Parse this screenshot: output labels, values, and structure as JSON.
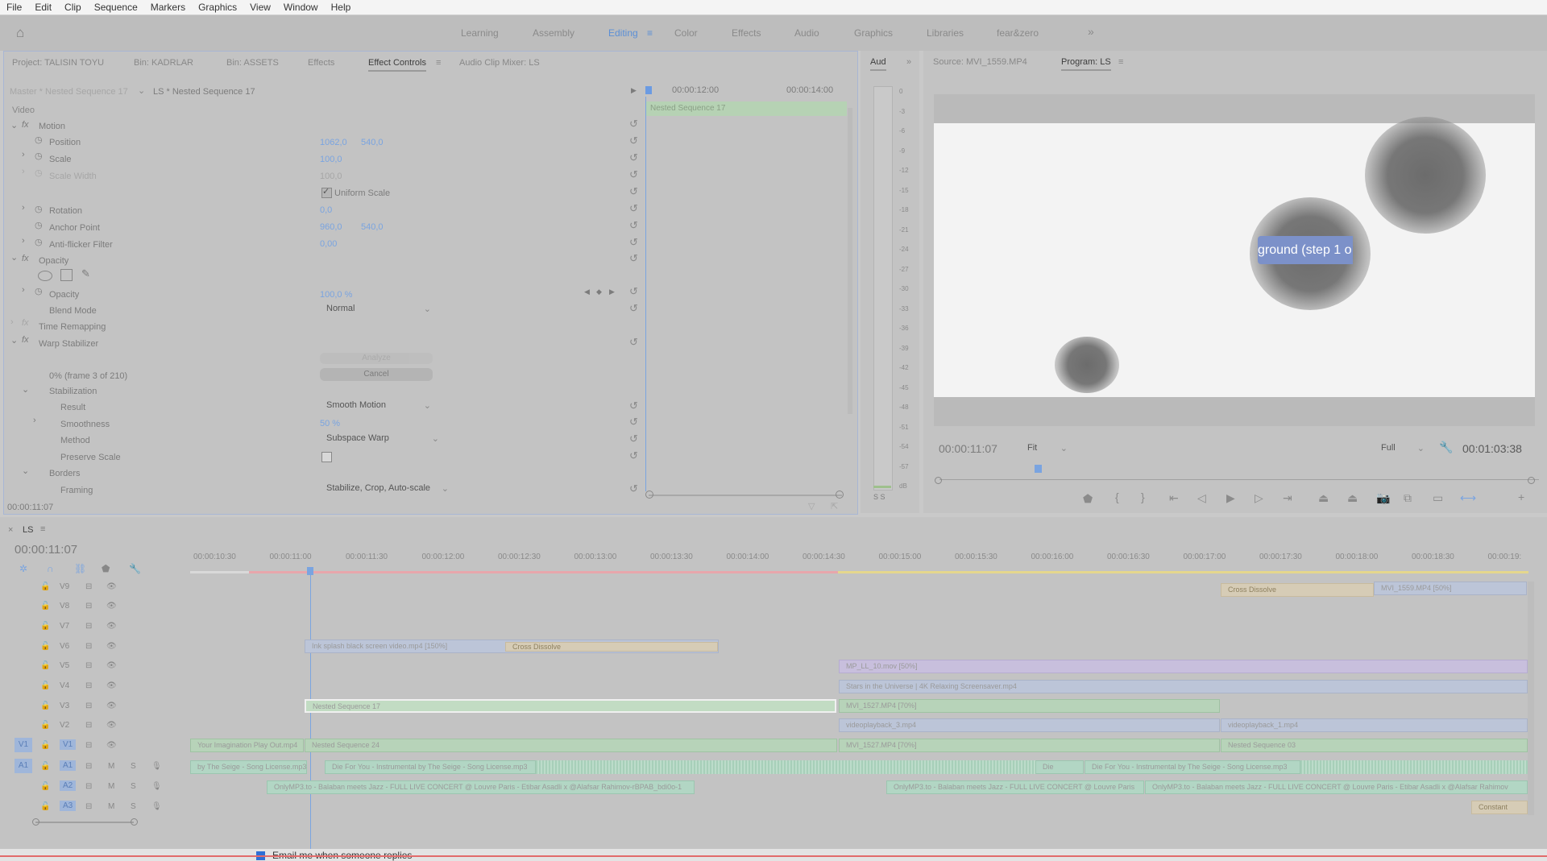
{
  "menu": [
    "File",
    "Edit",
    "Clip",
    "Sequence",
    "Markers",
    "Graphics",
    "View",
    "Window",
    "Help"
  ],
  "workspaces": [
    "Learning",
    "Assembly",
    "Editing",
    "Color",
    "Effects",
    "Audio",
    "Graphics",
    "Libraries",
    "fear&zero"
  ],
  "workspaces_more": "»",
  "left_tabs": [
    "Project: TALISIN TOYU",
    "Bin: KADRLAR",
    "Bin: ASSETS",
    "Effects",
    "Effect Controls",
    "Audio Clip Mixer: LS"
  ],
  "ec": {
    "master": "Master * Nested Sequence 17",
    "clip": "LS * Nested Sequence 17",
    "time1": "00:00:12:00",
    "time2": "00:00:14:00",
    "clip_bar": "Nested Sequence 17",
    "video_header": "Video",
    "motion": "Motion",
    "position": {
      "label": "Position",
      "x": "1062,0",
      "y": "540,0"
    },
    "scale": {
      "label": "Scale",
      "value": "100,0"
    },
    "scale_width": {
      "label": "Scale Width",
      "value": "100,0"
    },
    "uniform_scale": "Uniform Scale",
    "rotation": {
      "label": "Rotation",
      "value": "0,0"
    },
    "anchor": {
      "label": "Anchor Point",
      "x": "960,0",
      "y": "540,0"
    },
    "antiflicker": {
      "label": "Anti-flicker Filter",
      "value": "0,00"
    },
    "opacity_fx": "Opacity",
    "opacity": {
      "label": "Opacity",
      "value": "100,0 %"
    },
    "blend": {
      "label": "Blend Mode",
      "value": "Normal"
    },
    "time_remap": "Time Remapping",
    "warp": "Warp Stabilizer",
    "analyze": "Analyze",
    "progress": "0% (frame 3 of 210)",
    "cancel": "Cancel",
    "stabilization": "Stabilization",
    "result": {
      "label": "Result",
      "value": "Smooth Motion"
    },
    "smoothness": {
      "label": "Smoothness",
      "value": "50 %"
    },
    "method": {
      "label": "Method",
      "value": "Subspace Warp"
    },
    "preserve": "Preserve Scale",
    "borders": "Borders",
    "framing": {
      "label": "Framing",
      "value": "Stabilize, Crop, Auto-scale"
    },
    "footer_time": "00:00:11:07"
  },
  "audio_meter": {
    "tab": "Aud",
    "ticks": [
      "0",
      "-3",
      "-6",
      "-9",
      "-12",
      "-15",
      "-18",
      "-21",
      "-24",
      "-27",
      "-30",
      "-33",
      "-36",
      "-39",
      "-42",
      "-45",
      "-48",
      "-51",
      "-54",
      "-57",
      "dB"
    ],
    "footer": "S S"
  },
  "monitor": {
    "source_tab": "Source: MVI_1559.MP4",
    "program_tab": "Program: LS",
    "overlay_text": "ground (step 1 o",
    "timecode": "00:00:11:07",
    "fit": "Fit",
    "full": "Full",
    "duration": "00:01:03:38"
  },
  "timeline": {
    "tab": "LS",
    "timecode": "00:00:11:07",
    "ruler": [
      "00:00:10:30",
      "00:00:11:00",
      "00:00:11:30",
      "00:00:12:00",
      "00:00:12:30",
      "00:00:13:00",
      "00:00:13:30",
      "00:00:14:00",
      "00:00:14:30",
      "00:00:15:00",
      "00:00:15:30",
      "00:00:16:00",
      "00:00:16:30",
      "00:00:17:00",
      "00:00:17:30",
      "00:00:18:00",
      "00:00:18:30",
      "00:00:19:"
    ],
    "tracks": [
      "V9",
      "V8",
      "V7",
      "V6",
      "V5",
      "V4",
      "V3",
      "V2",
      "V1",
      "A1",
      "A2",
      "A3"
    ],
    "src_v": "V1",
    "src_a": "A1",
    "clips": {
      "v9_cross": "Cross Dissolve",
      "v9_mvi": "MVI_1559.MP4 [50%]",
      "v6_ink": "Ink splash black screen video.mp4 [150%]",
      "v6_cross": "Cross Dissolve",
      "v5_mp": "MP_LL_10.mov [50%]",
      "v4_stars": "Stars in the Universe | 4K Relaxing Screensaver.mp4",
      "v3_nested": "Nested Sequence 17",
      "v3_mvi": "MVI_1527.MP4 [70%]",
      "v2_vp3": "videoplayback_3.mp4",
      "v2_vp1": "videoplayback_1.mp4",
      "v1_your": "Your Imagination Play Out.mp4",
      "v1_nested24": "Nested Sequence 24",
      "v1_mvi": "MVI_1527.MP4 [70%]",
      "v1_nested03": "Nested Sequence 03",
      "a1_a": "by The Seige - Song License.mp3",
      "a1_b": "Die For You - Instrumental by The Seige - Song License.mp3",
      "a1_c": "Die",
      "a1_d": "Die For You - Instrumental by The Seige - Song License.mp3",
      "a2_a": "OnlyMP3.to - Balaban meets Jazz - FULL LIVE CONCERT @ Louvre Paris - Etibar Asadli x @Alafsar Rahimov-rBPAB_bdi0o-1",
      "a2_b": "OnlyMP3.to - Balaban meets Jazz - FULL LIVE CONCERT @ Louvre Paris",
      "a2_c": "OnlyMP3.to - Balaban meets Jazz - FULL LIVE CONCERT @ Louvre Paris - Etibar Asadli x @Alafsar Rahimov",
      "a3_a": "Constant"
    }
  },
  "bottom_overlay": "Email me when someone replies"
}
